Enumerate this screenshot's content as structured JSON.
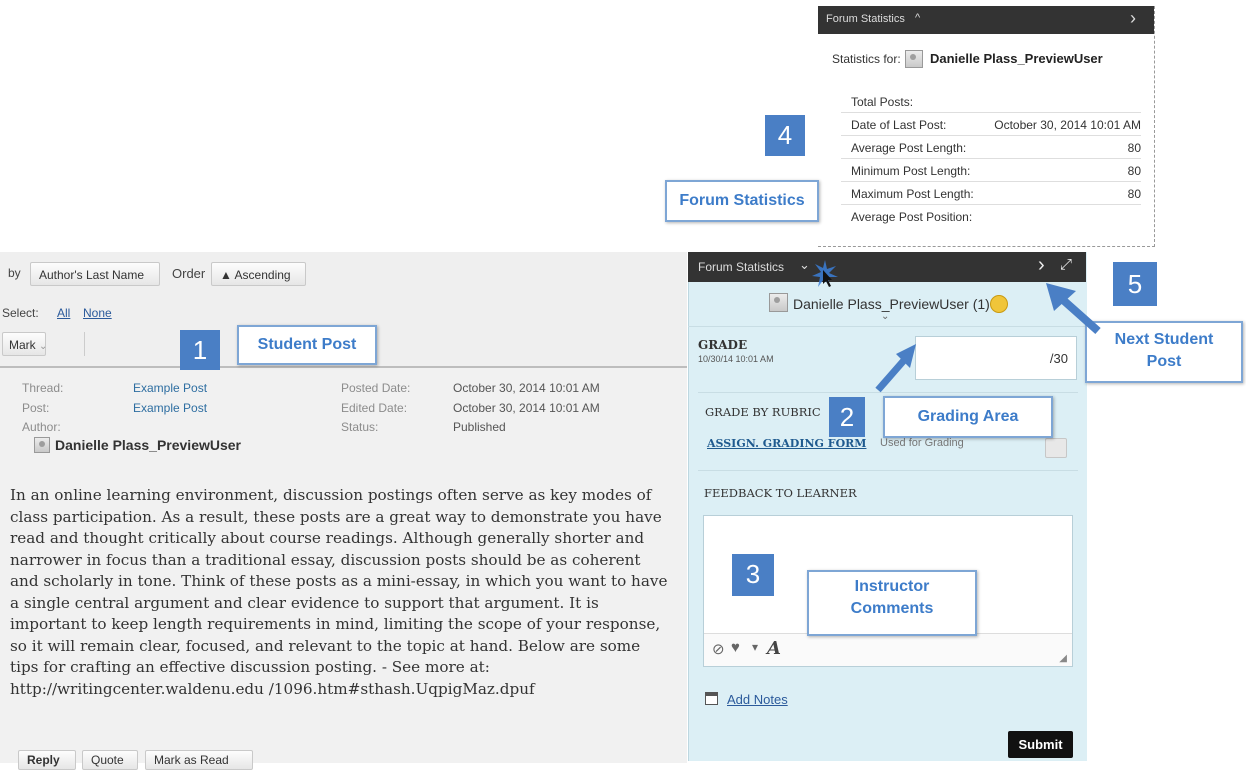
{
  "toolbar": {
    "sort_prefix": "by",
    "sort_button": "Author's Last Name",
    "order_label": "Order",
    "order_button": "▲ Ascending",
    "select_label": "Select:",
    "select_all": "All",
    "select_none": "None",
    "mark_button": "Mark",
    "mark_icon": "chevron-down-icon"
  },
  "post": {
    "meta": {
      "thread_label": "Thread:",
      "thread_value": "Example Post",
      "post_label": "Post:",
      "post_value": "Example Post",
      "author_label": "Author:",
      "posted_label": "Posted Date:",
      "posted_value": "October 30, 2014 10:01 AM",
      "edited_label": "Edited Date:",
      "edited_value": "October 30, 2014 10:01 AM",
      "status_label": "Status:",
      "status_value": "Published"
    },
    "author_name": "Danielle Plass_PreviewUser",
    "body": "In an online learning environment, discussion postings often serve as key modes of class participation. As a result, these posts are a great way to demonstrate you have read and thought critically about course readings. Although generally shorter and narrower in focus than a traditional essay, discussion posts should be as coherent and scholarly in tone. Think of these posts as a mini-essay, in which you want to have a single central argument and clear evidence to support that argument. It is important to keep length requirements in mind, limiting the scope of your response, so it will remain clear, focused, and relevant to the topic at hand. Below are some tips for crafting an effective discussion posting. - See more at: http://writingcenter.waldenu.edu /1096.htm#sthash.UqpigMaz.dpuf",
    "actions": [
      "Reply",
      "Quote",
      "Mark as Read"
    ]
  },
  "callouts": {
    "c1_num": "1",
    "c1_label": "Student Post",
    "c2_num": "2",
    "c2_label": "Grading Area",
    "c3_num": "3",
    "c3_label": "Instructor Comments",
    "c4_num": "4",
    "c4_label": "Forum Statistics",
    "c5_num": "5",
    "c5_label": "Next Student Post"
  },
  "stats_popup": {
    "title": "Forum Statistics",
    "chevron": "^",
    "next_icon": "›",
    "stats_for_label": "Statistics for:",
    "user": "Danielle Plass_PreviewUser",
    "rows": [
      {
        "label": "Total Posts:",
        "value": ""
      },
      {
        "label": "Date of Last Post:",
        "value": "October 30, 2014 10:01 AM"
      },
      {
        "label": "Average Post Length:",
        "value": "80"
      },
      {
        "label": "Minimum Post Length:",
        "value": "80"
      },
      {
        "label": "Maximum Post Length:",
        "value": "80"
      },
      {
        "label": "Average Post Position:",
        "value": ""
      }
    ]
  },
  "grading": {
    "bar_title": "Forum Statistics",
    "bar_chevron": "⌄",
    "next_icon": "›",
    "expand_icon": "⤢",
    "user": "Danielle Plass_PreviewUser (1)",
    "grade_label": "GRADE",
    "grade_date": "10/30/14 10:01 AM",
    "grade_value": "",
    "grade_total": "/30",
    "rubric_label": "GRADE BY RUBRIC",
    "rubric_link": "ASSIGN. GRADING FORM",
    "rubric_note": "Used for Grading",
    "feedback_label": "FEEDBACK TO LEARNER",
    "feedback_value": "",
    "add_notes": "Add Notes",
    "submit": "Submit"
  },
  "colors": {
    "accent_blue": "#4a7fc5",
    "callout_text": "#3d7cc9",
    "panel_bg": "#dceff5",
    "dark_bar": "#333333"
  }
}
